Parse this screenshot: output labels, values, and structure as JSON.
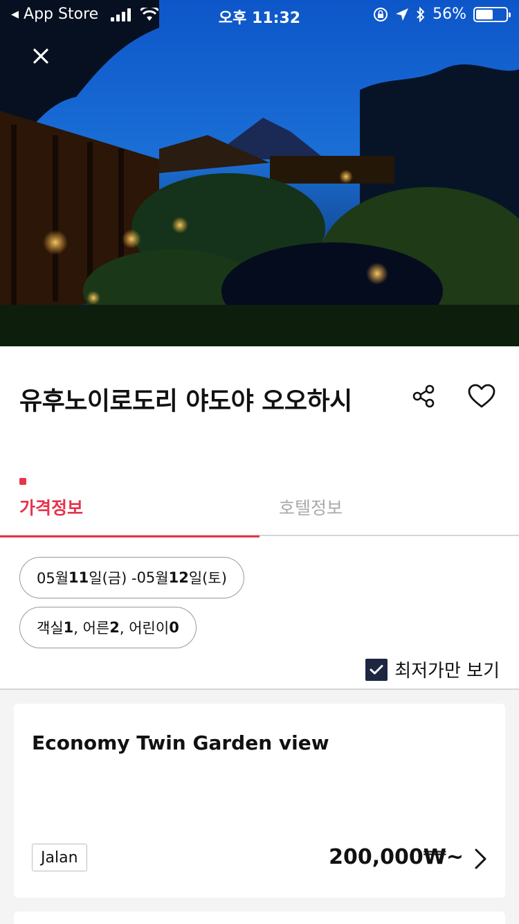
{
  "status_bar": {
    "back_app": "App Store",
    "time": "오후 11:32",
    "battery_percent_label": "56%",
    "battery_level": 0.56
  },
  "hero": {
    "close_icon": "close-icon"
  },
  "hotel": {
    "name": "유후노이로도리 야도야 오오하시",
    "share_icon": "share-icon",
    "favorite_icon": "heart-icon"
  },
  "tabs": [
    {
      "label": "가격정보",
      "active": true
    },
    {
      "label": "호텔정보",
      "active": false
    }
  ],
  "filters": {
    "date_parts": [
      "05월 ",
      "11",
      "일(금) - ",
      "05",
      "월 ",
      "12",
      "일(토)"
    ],
    "guest_parts": [
      "객실 ",
      "1",
      ", 어른 ",
      "2",
      ", 어린이 ",
      "0"
    ],
    "cheapest_only_label": "최저가만 보기",
    "cheapest_only_checked": true
  },
  "rooms": [
    {
      "name": "Economy Twin Garden view",
      "source": "Jalan",
      "price": "200,000₩~"
    }
  ],
  "colors": {
    "accent": "#e8334a",
    "checkbox": "#1d2742",
    "results_bg": "#f4f4f4"
  }
}
